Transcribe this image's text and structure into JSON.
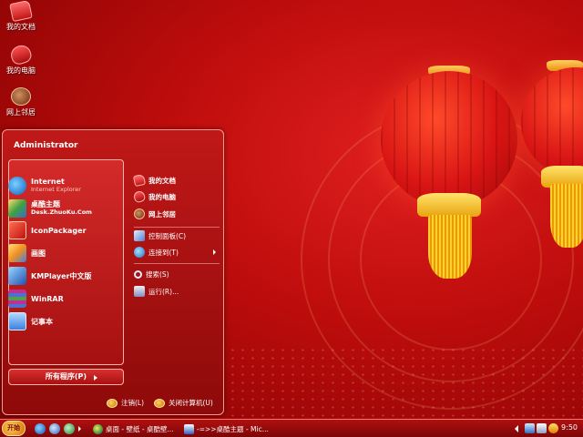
{
  "desktop": {
    "icons": [
      {
        "label": "我的文档",
        "icon": "folder-icon"
      },
      {
        "label": "我的电脑",
        "icon": "computer-icon"
      },
      {
        "label": "网上邻居",
        "icon": "network-icon"
      }
    ]
  },
  "start_menu": {
    "user": "Administrator",
    "pinned": [
      {
        "name": "Internet",
        "sub": "Internet Explorer",
        "icon": "ie-icon"
      },
      {
        "name": "桌酷主题",
        "sub": "Desk.ZhuoKu.Com",
        "icon": "zhuoku-icon"
      },
      {
        "name": "IconPackager",
        "sub": "",
        "icon": "iconpackager-icon"
      },
      {
        "name": "画图",
        "sub": "",
        "icon": "paint-icon"
      },
      {
        "name": "KMPlayer中文版",
        "sub": "",
        "icon": "kmplayer-icon"
      },
      {
        "name": "WinRAR",
        "sub": "",
        "icon": "winrar-icon"
      },
      {
        "name": "记事本",
        "sub": "",
        "icon": "notepad-icon"
      }
    ],
    "all_programs": "所有程序(P)",
    "right": {
      "places": [
        {
          "label": "我的文档",
          "icon": "folder-icon"
        },
        {
          "label": "我的电脑",
          "icon": "computer-icon"
        },
        {
          "label": "网上邻居",
          "icon": "network-icon"
        }
      ],
      "control_panel": "控制面板(C)",
      "connect_to": "连接到(T)",
      "search": "搜索(S)",
      "run": "运行(R)..."
    },
    "logoff": "注销(L)",
    "shutdown": "关闭计算机(U)"
  },
  "taskbar": {
    "start_label": "开始",
    "tasks": [
      {
        "label": "桌面 - 壁纸 - 桌酷壁...",
        "icon": "browser-icon"
      },
      {
        "label": "-=>>桌酷主题 - Mic...",
        "icon": "word-icon"
      }
    ],
    "clock": "9:50"
  },
  "colors": {
    "accent": "#c00d0d",
    "gold": "#ffd030"
  }
}
